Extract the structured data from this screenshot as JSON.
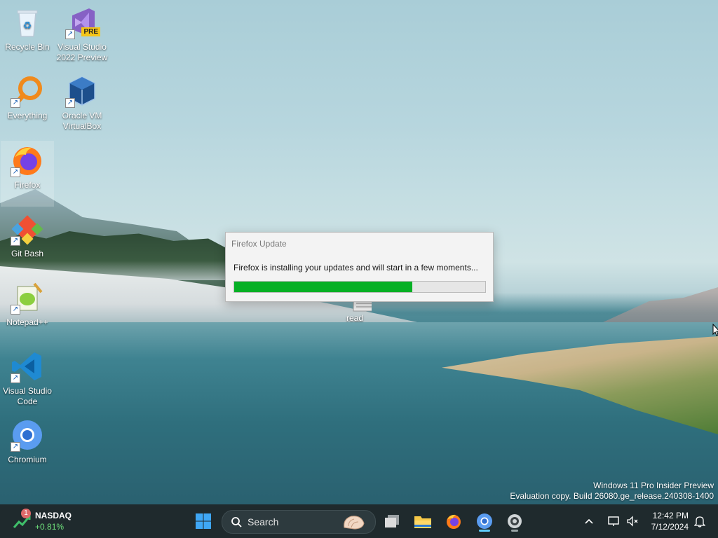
{
  "desktop": {
    "icons": [
      {
        "label": "Recycle Bin"
      },
      {
        "label": "Visual Studio 2022 Preview",
        "badge": "PRE"
      },
      {
        "label": "Everything"
      },
      {
        "label": "Oracle VM VirtualBox"
      },
      {
        "label": "Firefox"
      },
      {
        "label": "Git Bash"
      },
      {
        "label": "Notepad++"
      },
      {
        "label": "Visual Studio Code"
      },
      {
        "label": "Chromium"
      },
      {
        "label": "read"
      }
    ]
  },
  "dialog": {
    "title": "Firefox Update",
    "message": "Firefox is installing your updates and will start in a few moments...",
    "progress_fraction": 0.71
  },
  "watermark": {
    "line1": "Windows 11 Pro Insider Preview",
    "line2": "Evaluation copy. Build 26080.ge_release.240308-1400"
  },
  "taskbar": {
    "widget": {
      "badge": "1",
      "name": "NASDAQ",
      "change": "+0.81%"
    },
    "search_label": "Search",
    "clock": {
      "time": "12:42 PM",
      "date": "7/12/2024"
    }
  },
  "colors": {
    "progress_fill": "#06b025",
    "taskbar_bg": "#1f2a2d",
    "accent": "#60cdff"
  }
}
